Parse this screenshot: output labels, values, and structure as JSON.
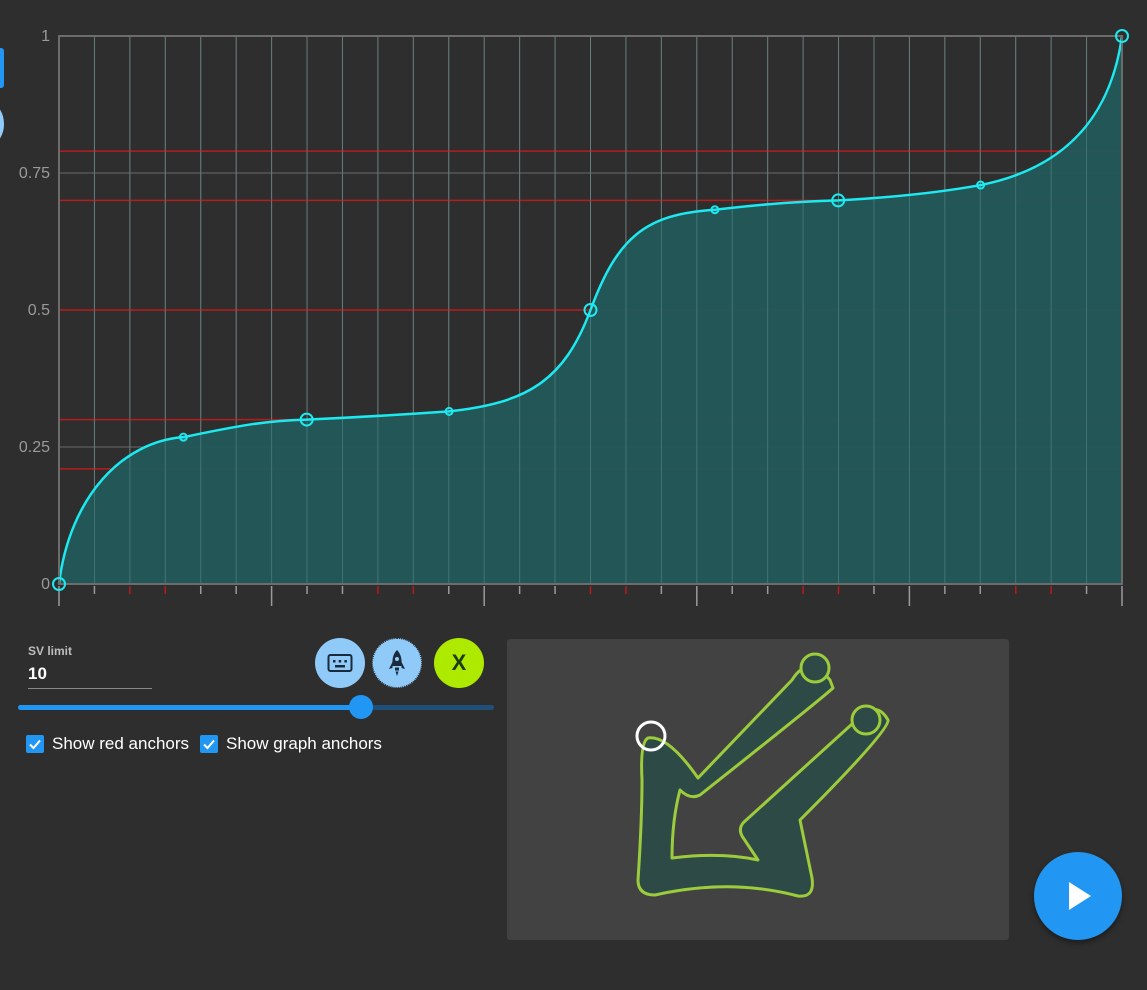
{
  "graph": {
    "y_labels": [
      "1",
      "0.75",
      "0.5",
      "0.25",
      "0"
    ],
    "colors": {
      "curve": "#1de9f0",
      "fill": "#22595a",
      "red_line": "#b71c1c",
      "grid": "#6c6c6c"
    },
    "chart_data": {
      "type": "area",
      "ylim": [
        0,
        1
      ],
      "xlim": [
        0,
        1
      ],
      "red_anchor_y": [
        0.21,
        0.3,
        0.5,
        0.7,
        0.79
      ],
      "main_anchors": [
        [
          0,
          0
        ],
        [
          0.233,
          0.3
        ],
        [
          0.5,
          0.5
        ],
        [
          0.733,
          0.7
        ],
        [
          1,
          1
        ]
      ],
      "handle_points": [
        [
          0.117,
          0.268
        ],
        [
          0.367,
          0.315
        ],
        [
          0.617,
          0.683
        ],
        [
          0.867,
          0.728
        ]
      ]
    }
  },
  "controls": {
    "sv_limit_label": "SV limit",
    "sv_limit_value": "10",
    "slider_value": 0.72,
    "keyboard_icon": "keyboard-icon",
    "rocket_icon": "rocket-icon",
    "x_button_label": "X",
    "checkbox_red": "Show red anchors",
    "checkbox_graph": "Show graph anchors",
    "red_checked": true,
    "graph_checked": true
  },
  "preview": {
    "slider_colors": {
      "body": "#2d4a47",
      "outline": "#9ccc3c",
      "head": "#ffffff"
    }
  },
  "play_icon": "play-icon"
}
